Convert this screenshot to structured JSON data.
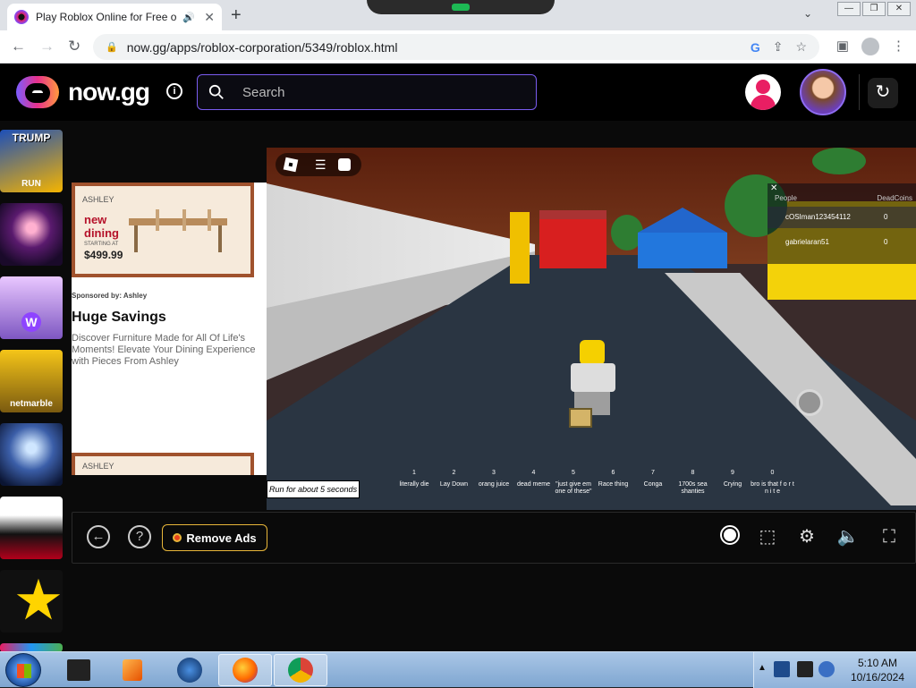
{
  "browser": {
    "tab_title": "Play Roblox Online for Free o",
    "tab_audio_icon": "speaker-icon",
    "url": "now.gg/apps/roblox-corporation/5349/roblox.html",
    "new_tab_label": "+",
    "close_tab_label": "✕"
  },
  "header": {
    "logo_text": "now.gg",
    "info_label": "i",
    "search_placeholder": "Search",
    "accent_color": "#7a5cf0"
  },
  "sidebar": {
    "games": [
      {
        "name": "trump-run",
        "title_top": "TRUMP",
        "title_bottom": "RUN"
      },
      {
        "name": "anime-game"
      },
      {
        "name": "w-game"
      },
      {
        "name": "netmarble-game",
        "label": "netmarble"
      },
      {
        "name": "fantasy-game"
      },
      {
        "name": "shadow-fight"
      },
      {
        "name": "star-game"
      }
    ]
  },
  "ad": {
    "brand": "ASHLEY",
    "image_headline": "new dining",
    "image_small": "STARTING AT",
    "price": "$499.99",
    "sponsor": "Sponsored by: Ashley",
    "headline": "Huge Savings",
    "description": "Discover Furniture Made for All Of Life's Moments! Elevate Your Dining Experience with Pieces From Ashley",
    "brand2": "ASHLEY"
  },
  "game": {
    "leaderboard": {
      "close": "✕",
      "col_people": "People",
      "col_coins": "DeadCoins",
      "rows": [
        {
          "name": "cOSIman123454112",
          "value": "0"
        },
        {
          "name": "gabrielaran51",
          "value": "0"
        }
      ]
    },
    "hotbar": [
      {
        "num": "1",
        "label": "literally die"
      },
      {
        "num": "2",
        "label": "Lay Down"
      },
      {
        "num": "3",
        "label": "orang juice"
      },
      {
        "num": "4",
        "label": "dead meme"
      },
      {
        "num": "5",
        "label": "\"just give em one of these\""
      },
      {
        "num": "6",
        "label": "Race thing"
      },
      {
        "num": "7",
        "label": "Conga"
      },
      {
        "num": "8",
        "label": "1700s sea shanties"
      },
      {
        "num": "9",
        "label": "Crying"
      },
      {
        "num": "0",
        "label": "bro is that f o r t n i t e"
      }
    ],
    "caption": "Run for about 5 seconds"
  },
  "controls": {
    "back_icon": "arrow-left-icon",
    "help_label": "?",
    "remove_ads_label": "Remove Ads"
  },
  "taskbar": {
    "time": "5:10 AM",
    "date": "10/16/2024"
  }
}
